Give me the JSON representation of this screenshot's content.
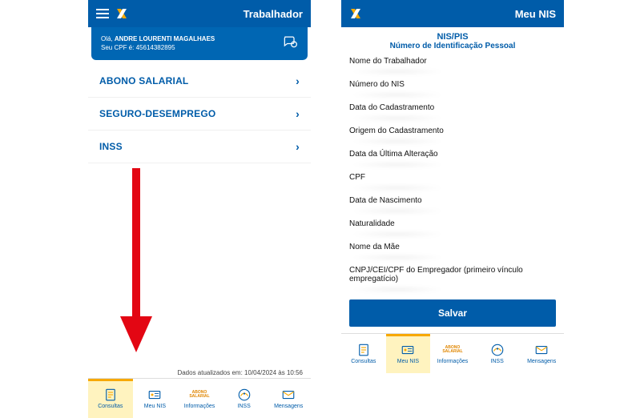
{
  "left": {
    "topbar_title": "Trabalhador",
    "user_greeting_prefix": "Olá,",
    "user_name": "ANDRE LOURENTI MAGALHAES",
    "cpf_label": "Seu CPF é:",
    "cpf_value": "45614382895",
    "menu": [
      {
        "label": "ABONO SALARIAL"
      },
      {
        "label": "SEGURO-DESEMPREGO"
      },
      {
        "label": "INSS"
      }
    ],
    "update_text": "Dados atualizados em: 10/04/2024 às 10:56",
    "tabs": [
      {
        "label": "Consultas",
        "icon": "doc"
      },
      {
        "label": "Meu NIS",
        "icon": "card"
      },
      {
        "label": "Informações",
        "icon": "abono"
      },
      {
        "label": "INSS",
        "icon": "inss"
      },
      {
        "label": "Mensagens",
        "icon": "mail"
      }
    ],
    "active_tab": 0
  },
  "right": {
    "topbar_title": "Meu NIS",
    "header_line1": "NIS/PIS",
    "header_line2": "Número de Identificação Pessoal",
    "fields": [
      "Nome do Trabalhador",
      "Número do NIS",
      "Data do Cadastramento",
      "Origem do Cadastramento",
      "Data da Última Alteração",
      "CPF",
      "Data de Nascimento",
      "Naturalidade",
      "Nome da Mãe",
      "CNPJ/CEI/CPF do Empregador (primeiro vínculo empregatício)"
    ],
    "save_label": "Salvar",
    "tabs": [
      {
        "label": "Consultas",
        "icon": "doc"
      },
      {
        "label": "Meu NIS",
        "icon": "card"
      },
      {
        "label": "Informações",
        "icon": "abono"
      },
      {
        "label": "INSS",
        "icon": "inss"
      },
      {
        "label": "Mensagens",
        "icon": "mail"
      }
    ],
    "active_tab": 1
  },
  "abono_icon_text": "ABONO SALARIAL"
}
